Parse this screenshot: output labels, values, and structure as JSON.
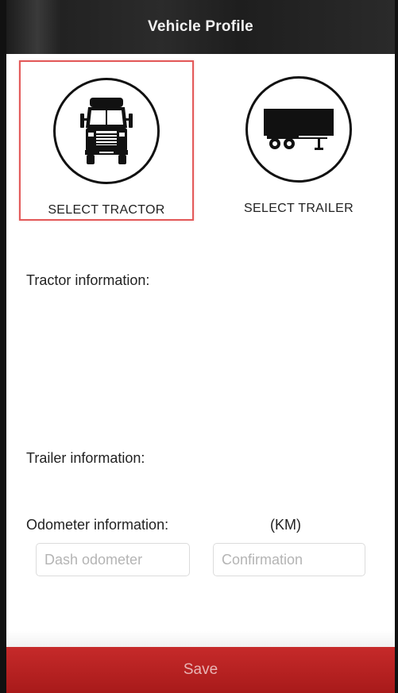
{
  "header": {
    "title": "Vehicle Profile"
  },
  "selectors": {
    "tractor": {
      "label": "SELECT TRACTOR",
      "icon": "truck-icon",
      "selected": true
    },
    "trailer": {
      "label": "SELECT TRAILER",
      "icon": "trailer-icon",
      "selected": false
    }
  },
  "sections": {
    "tractor_info": "Tractor information:",
    "trailer_info": "Trailer information:",
    "odometer_info": "Odometer information:",
    "odometer_unit": "(KM)"
  },
  "odometer": {
    "dash_placeholder": "Dash odometer",
    "dash_value": "",
    "confirm_placeholder": "Confirmation",
    "confirm_value": ""
  },
  "actions": {
    "save_label": "Save"
  },
  "colors": {
    "accent": "#b82222",
    "selection_border": "#e35a5a",
    "header_bg": "#252525"
  }
}
